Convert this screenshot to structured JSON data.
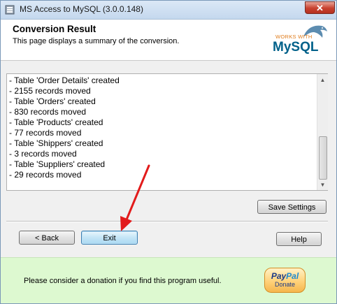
{
  "window": {
    "title": "MS Access to MySQL (3.0.0.148)",
    "close_label": "✕"
  },
  "header": {
    "title": "Conversion Result",
    "subtitle": "This page displays a summary of the conversion.",
    "logo_works_with": "WORKS WITH",
    "logo_mysql": "MySQL"
  },
  "log": {
    "lines": [
      "- Table 'Order Details' created",
      "- 2155 records moved",
      "- Table 'Orders' created",
      "- 830 records moved",
      "- Table 'Products' created",
      "- 77 records moved",
      "- Table 'Shippers' created",
      "- 3 records moved",
      "- Table 'Suppliers' created",
      "- 29 records moved"
    ]
  },
  "buttons": {
    "save_settings": "Save Settings",
    "back": "< Back",
    "exit": "Exit",
    "help": "Help"
  },
  "footer": {
    "donation_text": "Please consider a donation if you find this program useful.",
    "paypal_pay": "Pay",
    "paypal_pal": "Pal",
    "paypal_donate": "Donate"
  },
  "colors": {
    "footer_bg": "#ddf9d0",
    "arrow": "#e21b1b",
    "mysql_blue": "#00618a",
    "mysql_orange": "#e07b1a"
  },
  "icons": {
    "app": "database-icon",
    "close": "close-icon",
    "scroll_up": "scroll-up-arrow-icon",
    "scroll_down": "scroll-down-arrow-icon",
    "annotation": "red-arrow-annotation"
  }
}
